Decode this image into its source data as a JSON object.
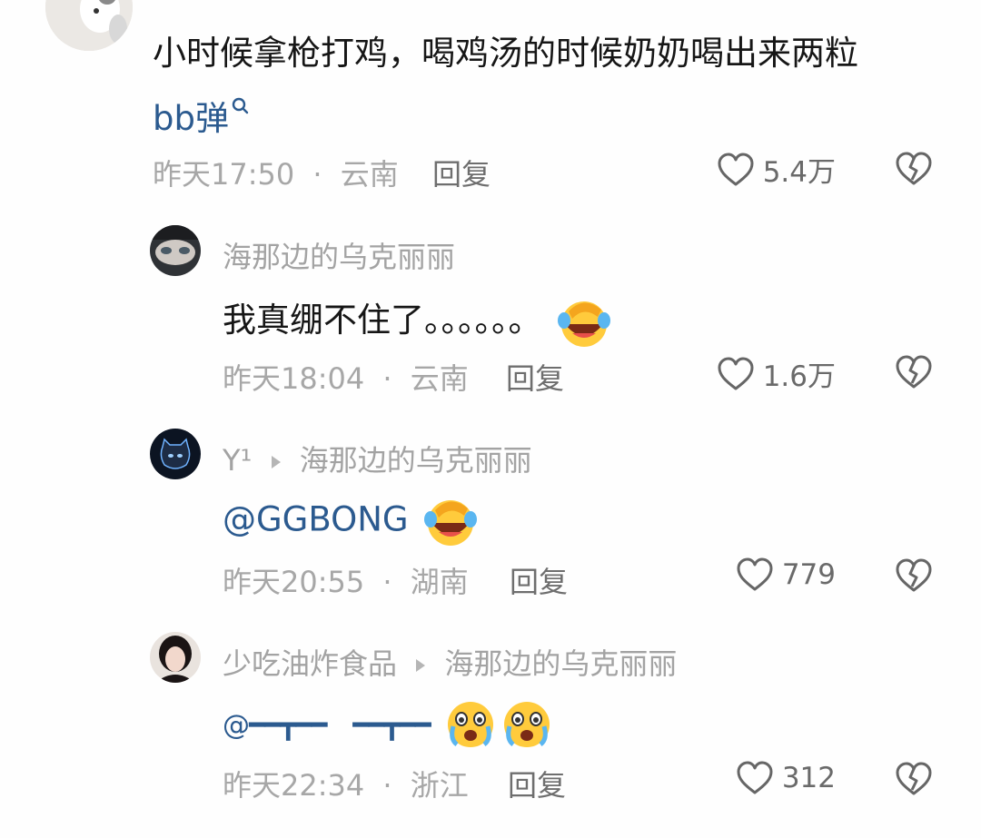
{
  "comments": [
    {
      "text": "小时候拿枪打鸡，喝鸡汤的时候奶奶喝出来两粒",
      "link_text": "bb弹",
      "time": "昨天17:50",
      "location": "云南",
      "reply_label": "回复",
      "likes": "5.4万"
    },
    {
      "user": "海那边的乌克丽丽",
      "text": "我真绷不住了。。。。。。",
      "emoji": "facepalm-laugh",
      "time": "昨天18:04",
      "location": "云南",
      "reply_label": "回复",
      "likes": "1.6万"
    },
    {
      "user": "Y¹",
      "reply_to": "海那边的乌克丽丽",
      "mention": "@GGBONG",
      "emoji": "facepalm-laugh",
      "time": "昨天20:55",
      "location": "湖南",
      "reply_label": "回复",
      "likes": "779"
    },
    {
      "user": "少吃油炸食品",
      "reply_to": "海那边的乌克丽丽",
      "mention": "@━━┳━━　━━┳━━",
      "emoji": "teary-awe",
      "time": "昨天22:34",
      "location": "浙江",
      "reply_label": "回复",
      "likes": "312"
    }
  ],
  "separator": "·",
  "icons": [
    "cat-avatar",
    "like-heart-icon",
    "dislike-broken-heart-icon",
    "search-icon",
    "reply-arrow-icon"
  ],
  "colors": {
    "link": "#2b5a8f",
    "meta": "#a7a7a7",
    "text": "#161616"
  }
}
